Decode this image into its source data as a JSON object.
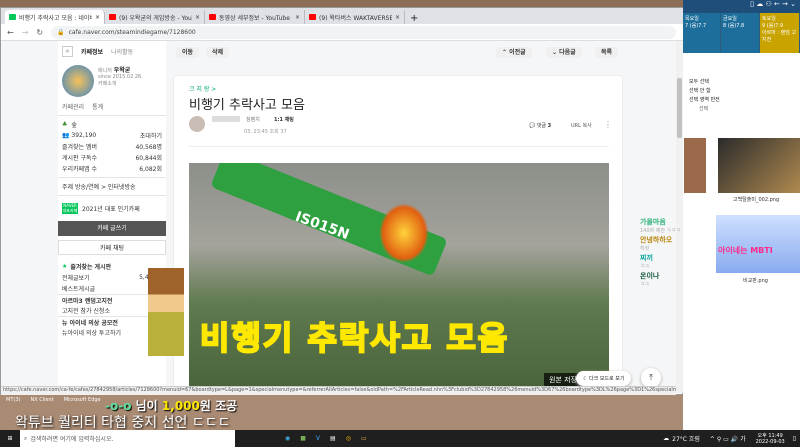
{
  "browser": {
    "tabs": [
      {
        "label": "비행기 추락사고 모음 : 네이버 카페",
        "color": "#03c75a",
        "active": true
      },
      {
        "label": "(9) 우왁굳의 게임방송 - YouTube",
        "color": "#ff0000"
      },
      {
        "label": "동영상 세부정보 - YouTube Studio",
        "color": "#ff0000"
      },
      {
        "label": "(9) 왁타버스 WAKTAVERSE - YouTube",
        "color": "#ff0000"
      }
    ],
    "new_tab": "+",
    "close": "×",
    "url": "cafe.naver.com/steamindiegame/7128600",
    "status_url": "https://cafe.naver.com/ca-fe/cafes/27842958/articles/7128600?menuid=67&boardtype=L&page=1&specialmenutype=&referrerAllArticles=false&oldPath=%2FArticleRead.nhn%3Fclubid%3D27842958%26menuid%3D67%26boardtype%3DL%26page%3D1%26specialmenutype%3D%26articleid..."
  },
  "sidebar": {
    "tab_info": "카페정보",
    "tab_activity": "나의활동",
    "manager_label": "매니저",
    "manager_name": "우왁굳",
    "since": "since 2015.02.26.",
    "intro": "카페소개",
    "admin": "카페관리",
    "stats": "통계",
    "level": "숲",
    "members": "392,190",
    "invite": "초대하기",
    "fav_members_label": "즐겨찾는 멤버",
    "fav_members": "40,568명",
    "board_sub_label": "게시판 구독수",
    "board_sub": "60,844회",
    "app_label": "우리카페앱 수",
    "app": "6,082회",
    "topic": "주제 방송/연예 > 인터넷방송",
    "naver_badge": "NAVER 대표카페",
    "award": "2021년 대표 인기카페",
    "write": "카페 글쓰기",
    "chat": "카페 채팅",
    "fav_boards": "즐겨찾는 게시판",
    "all_posts": "전체글보기",
    "all_count": "5,495,1",
    "best": "베스트게시글",
    "section1": "아르마3 랜덤고지전",
    "s1_item": "고지전 참가 신청소",
    "section2": "뉴 아이네 의상 공모전",
    "s2_item": "뉴아이네 의상 투고하기"
  },
  "article": {
    "move": "이동",
    "delete": "삭제",
    "prev": "이전글",
    "next": "다음글",
    "list": "목록",
    "board": "크 지 랑 >",
    "title": "비행기 추락사고 모음",
    "author_level": "침팬치",
    "chat": "1:1 채팅",
    "meta": "03. 23:45  조회 37",
    "comments_label": "댓글",
    "comments": "3",
    "url_copy": "URL 복사",
    "plane_text": "IS015N",
    "dark_mode": "다크 모드로 보기",
    "original": "원본 저장"
  },
  "overlay": {
    "title": "비행기 추락사고 모음",
    "donation_name": "-o-o",
    "donation_text": "님이",
    "donation_amount": "1,000",
    "donation_tail": "원 조공",
    "headline": "왁튜브 퀄리티 타협 중지 선언 ㄷㄷㄷ",
    "desktop_icons": [
      "MT(3)",
      "NX Client",
      "Microsoft Edge"
    ]
  },
  "right": {
    "days": [
      "목요일",
      "금요일",
      "토요일"
    ],
    "events": [
      "7 (음)7.7",
      "8 (음)7.8",
      "9 (음)7.9"
    ],
    "event_note": "아르마 : 랜덤 고지전",
    "select_all": "모두 선택",
    "select_none": "선택 안 함",
    "invert": "선택 영역 반전",
    "select": "선택",
    "file1": "고백탈출미_002.png",
    "file2": "비교판.png",
    "chat": [
      {
        "name": "가을마음",
        "msg": "140자 제한 ㅋㅋㅋ",
        "color": "#2fb37a"
      },
      {
        "name": "안녕하하오",
        "msg": "히힛",
        "color": "#b8860b"
      },
      {
        "name": "찌끼",
        "msg": "ㅋㅋ",
        "color": "#10a8a0"
      },
      {
        "name": "온이나",
        "msg": "ㅋㅋ",
        "color": "#10553a"
      }
    ],
    "mbti": "아이네는 MBTI"
  },
  "taskbar": {
    "search": "검색하려면 여기에 입력하십시오.",
    "weather": "27°C 흐림",
    "time": "오후 11:49",
    "date": "2022-09-03"
  }
}
